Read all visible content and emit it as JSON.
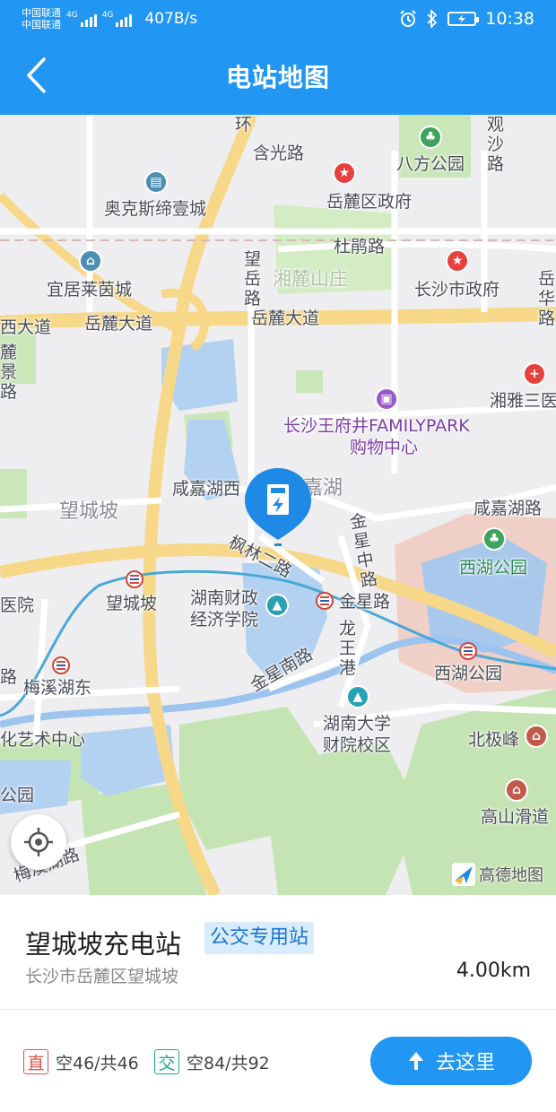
{
  "status_bar": {
    "carrier_1": "中国联通",
    "carrier_2": "中国联通",
    "net_1": "4G",
    "net_2": "4G",
    "net_speed": "407B/s",
    "time": "10:38",
    "icons": [
      "signal-icon",
      "alarm-icon",
      "bluetooth-icon",
      "battery-icon"
    ]
  },
  "header": {
    "title": "电站地图",
    "back_icon": "chevron-left-icon",
    "background_color": "#2196f3"
  },
  "map": {
    "labels": {
      "road_huan": "环",
      "road_hanguang": "含光路",
      "road_guansha": "观沙路",
      "park_bafang": "八方公园",
      "yuelu_gov": "岳麓区政府",
      "aokesi": "奥克斯缔壹城",
      "dujuan": "杜鹃路",
      "wangyue": "望岳路",
      "xianglu": "湘麓山庄",
      "yijulai": "宜居莱茵城",
      "changsha_gov": "长沙市政府",
      "yuehua": "岳华路",
      "xidadao": "西大道",
      "yuelu_avenue_1": "岳麓大道",
      "yuelu_avenue_2": "岳麓大道",
      "xiangya": "湘雅三医",
      "yuelu_jing": "麓景路",
      "wangfujing": "长沙王府井FAMILYPARK",
      "wangfujing_sub": "购物中心",
      "xianjiahu_xi": "咸嘉湖西",
      "xianjiahu": "嘉湖",
      "xianjiahu_road": "咸嘉湖路",
      "wangchengpo": "望城坡",
      "jinxing_middle": "金星中路",
      "fenglin": "枫林二路",
      "xihu_park": "西湖公园",
      "yiyuan": "医院",
      "wangchengpo_metro": "望城坡",
      "hncaizheng": "湖南财政",
      "hncaizheng_2": "经济学院",
      "jinxing_road": "金星路",
      "longwang": "龙王港",
      "lu_left": "路",
      "meixihu_east": "梅溪湖东",
      "jinxing_south": "金星南路",
      "xihu_park_metro": "西湖公园",
      "hunan_univ": "湖南大学",
      "hunan_univ_2": "财院校区",
      "culture_center": "化艺术中心",
      "beijifeng": "北极峰",
      "park_left": "公园",
      "gaoshan": "高山滑道",
      "meixihu_road": "梅溪湖路"
    },
    "attribution": "高德地图",
    "station_pin_icon": "charging-station-icon",
    "locate_icon": "locate-icon"
  },
  "station": {
    "name": "望城坡充电站",
    "tag": "公交专用站",
    "address": "长沙市岳麓区望城坡",
    "distance": "4.00km",
    "dc": {
      "label": "直",
      "count": "空46/共46",
      "color": "#e0524a"
    },
    "ac": {
      "label": "交",
      "count": "空84/共92",
      "color": "#1fa58a"
    },
    "go_button": "去这里",
    "go_icon": "navigate-arrow-icon"
  }
}
